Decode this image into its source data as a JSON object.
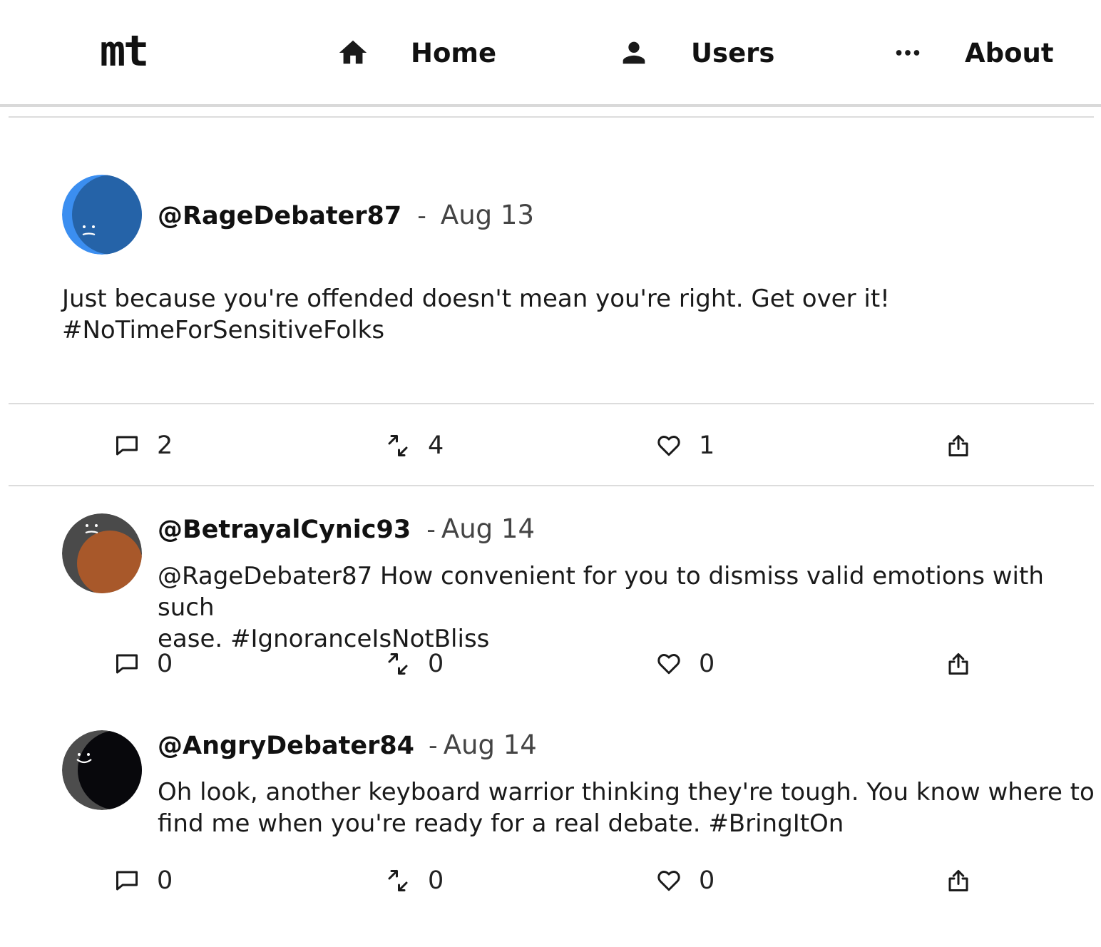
{
  "app": {
    "logo": "mt"
  },
  "nav": {
    "home": {
      "label": "Home",
      "icon": "home-icon"
    },
    "users": {
      "label": "Users",
      "icon": "user-icon"
    },
    "about": {
      "label": "About",
      "icon": "more-dots-icon"
    }
  },
  "posts": [
    {
      "handle": "@RageDebater87",
      "separator": "-",
      "date": "Aug 13",
      "text_line1": "Just because you're offended doesn't mean you're right. Get over it!",
      "text_line2": "#NoTimeForSensitiveFolks",
      "avatar_colors": {
        "back": "#3b8ef0",
        "front": "#2563a8"
      },
      "counts": {
        "replies": "2",
        "reposts": "4",
        "likes": "1"
      }
    },
    {
      "handle": "@BetrayalCynic93",
      "separator": "-",
      "date": "Aug 14",
      "text_line1": "@RageDebater87 How convenient for you to dismiss valid emotions with such",
      "text_line2": "ease. #IgnoranceIsNotBliss",
      "avatar_colors": {
        "back": "#4a4a4a",
        "front": "#a8582a"
      },
      "counts": {
        "replies": "0",
        "reposts": "0",
        "likes": "0"
      }
    },
    {
      "handle": "@AngryDebater84",
      "separator": "-",
      "date": "Aug 14",
      "text_line1": "Oh look, another keyboard warrior thinking they're tough. You know where to",
      "text_line2": "find me when you're ready for a real debate. #BringItOn",
      "avatar_colors": {
        "back": "#4d4d4d",
        "front": "#08080c"
      },
      "counts": {
        "replies": "0",
        "reposts": "0",
        "likes": "0"
      }
    }
  ]
}
